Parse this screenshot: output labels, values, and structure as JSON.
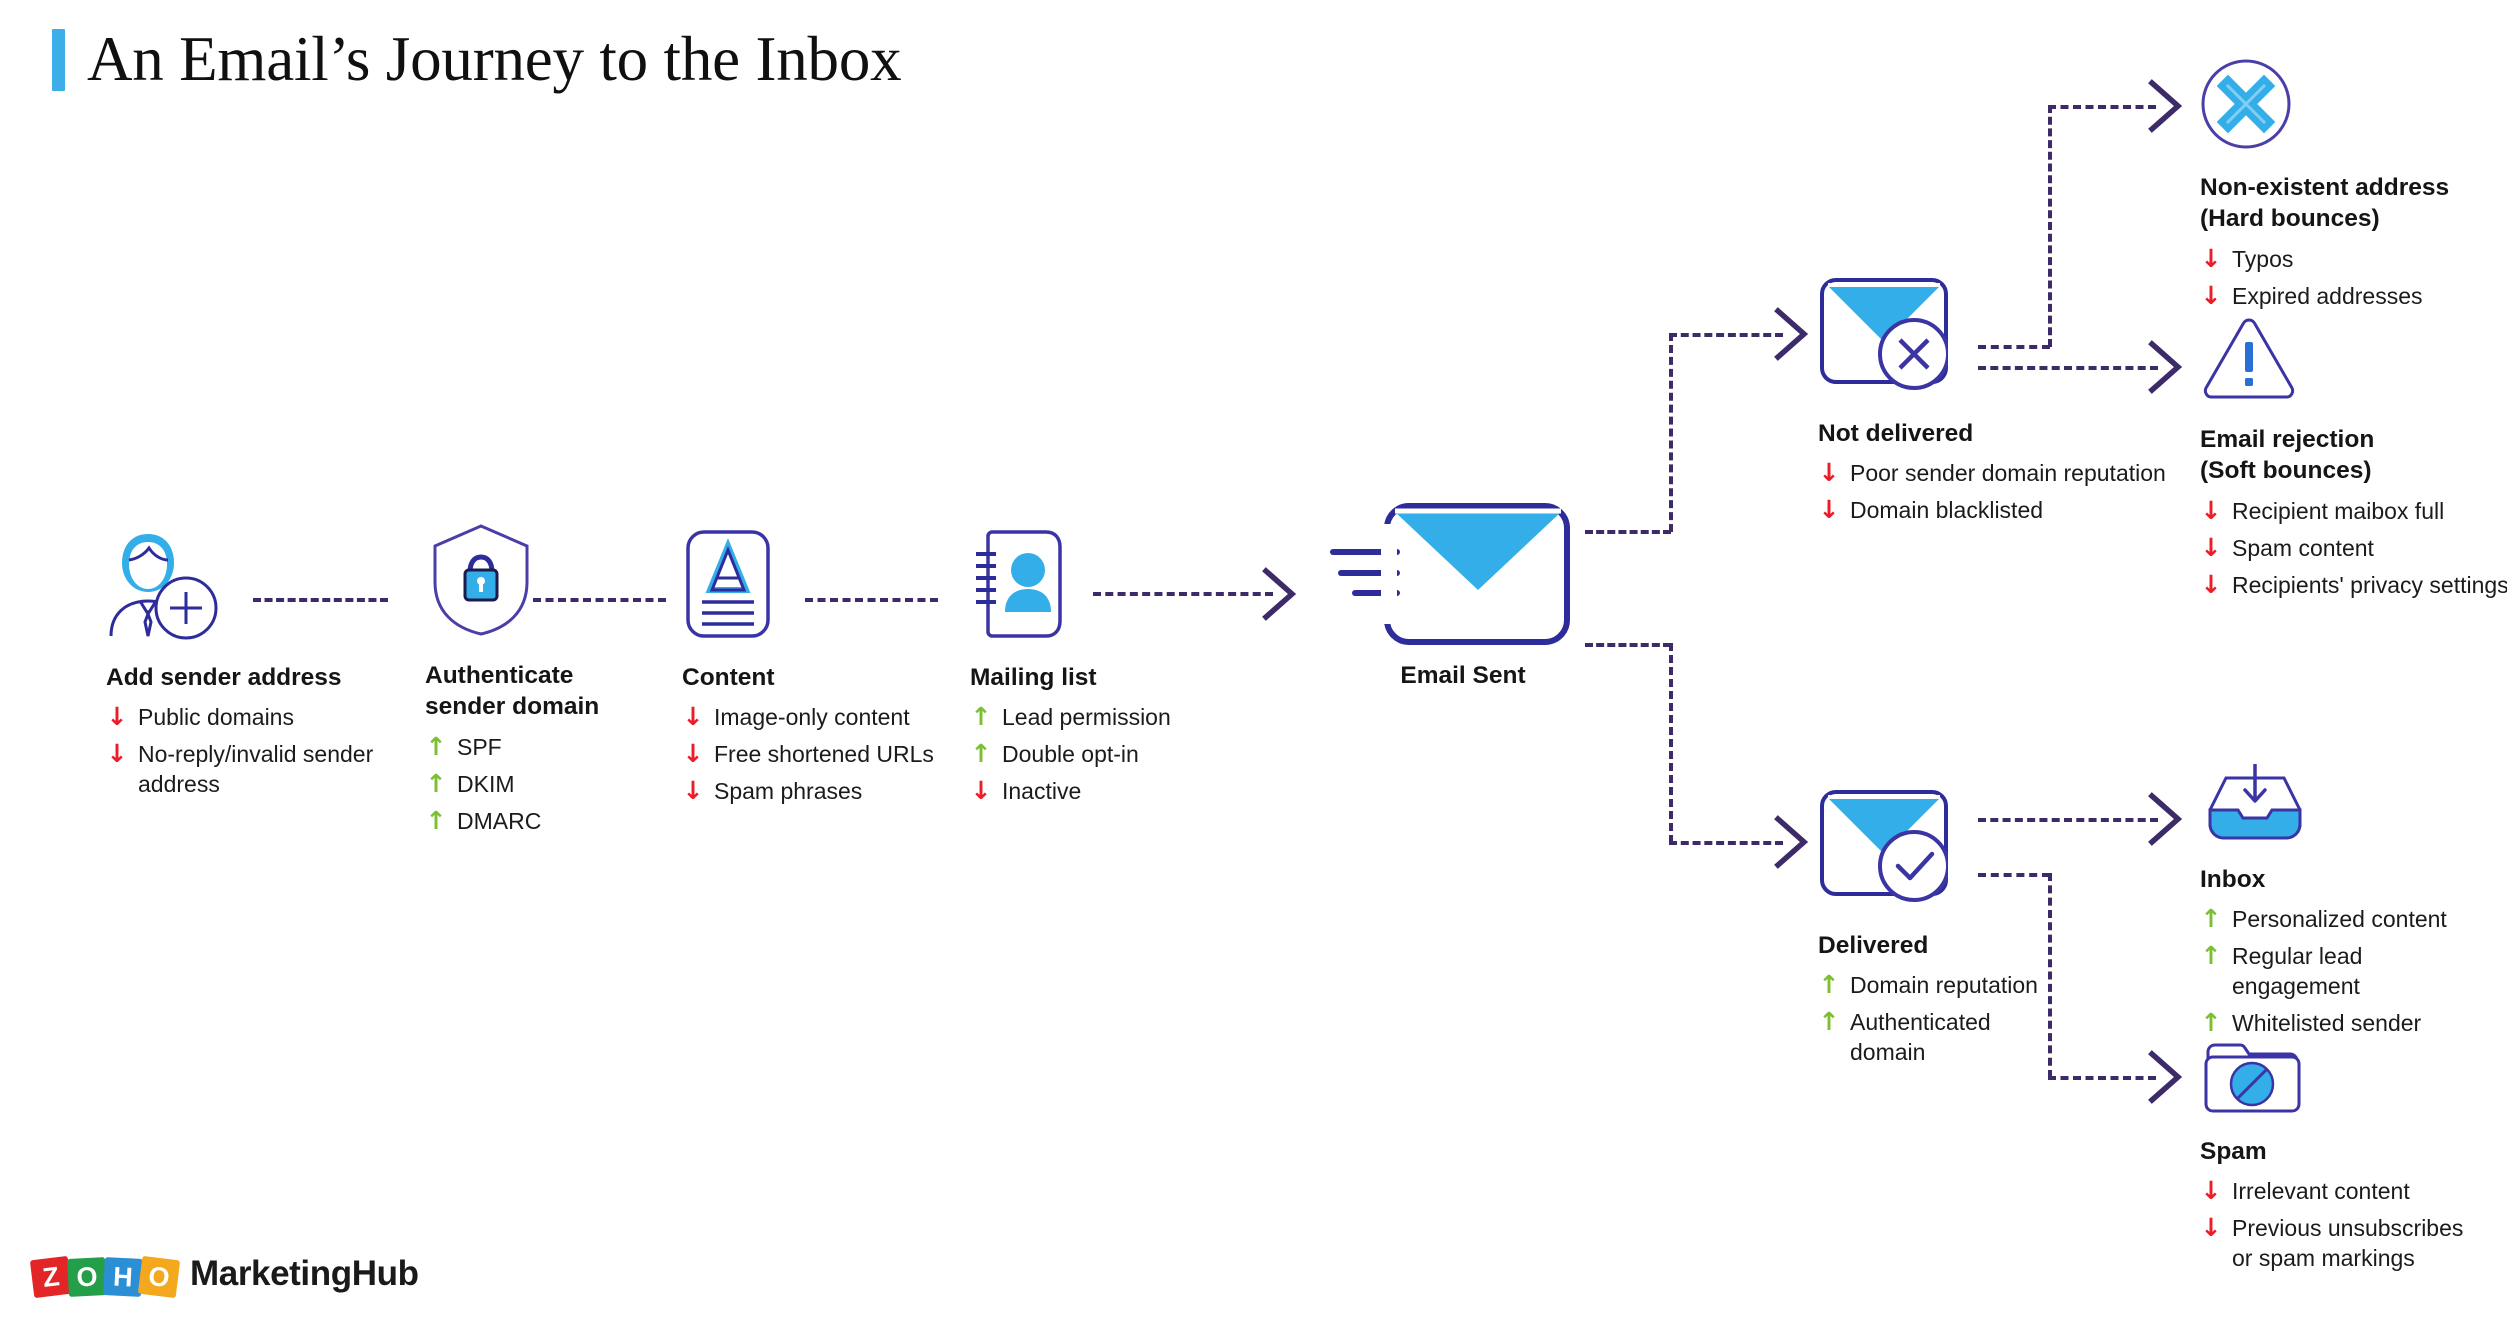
{
  "header": {
    "title": "An Email’s Journey to the Inbox",
    "accent_color": "#3DAEE8"
  },
  "colors": {
    "negative_arrow": "#EC1C28",
    "positive_arrow": "#7DBF32",
    "connector": "#3C2B68",
    "icon_outline": "#2E2C9B",
    "icon_fill": "#33AEE8"
  },
  "glyphs": {
    "down": "↓",
    "up": "↑"
  },
  "pipeline": [
    {
      "id": "add-sender-address",
      "icon": "user-add-icon",
      "title": "Add sender address",
      "bullets": [
        {
          "dir": "down",
          "text": "Public domains"
        },
        {
          "dir": "down",
          "text": "No-reply/invalid sender\naddress"
        }
      ]
    },
    {
      "id": "authenticate-sender-domain",
      "icon": "shield-lock-icon",
      "title": "Authenticate\nsender domain",
      "bullets": [
        {
          "dir": "up",
          "text": "SPF"
        },
        {
          "dir": "up",
          "text": "DKIM"
        },
        {
          "dir": "up",
          "text": "DMARC"
        }
      ]
    },
    {
      "id": "content",
      "icon": "document-text-icon",
      "title": "Content",
      "bullets": [
        {
          "dir": "down",
          "text": "Image-only content"
        },
        {
          "dir": "down",
          "text": "Free shortened URLs"
        },
        {
          "dir": "down",
          "text": "Spam phrases"
        }
      ]
    },
    {
      "id": "mailing-list",
      "icon": "contact-card-icon",
      "title": "Mailing list",
      "bullets": [
        {
          "dir": "up",
          "text": "Lead permission"
        },
        {
          "dir": "up",
          "text": "Double opt-in"
        },
        {
          "dir": "down",
          "text": "Inactive"
        }
      ]
    }
  ],
  "email_sent": {
    "id": "email-sent",
    "icon": "envelope-sending-icon",
    "title": "Email Sent"
  },
  "branches": {
    "not_delivered": {
      "id": "not-delivered",
      "icon": "envelope-x-icon",
      "title": "Not delivered",
      "bullets": [
        {
          "dir": "down",
          "text": "Poor sender domain reputation"
        },
        {
          "dir": "down",
          "text": "Domain blacklisted"
        }
      ]
    },
    "delivered": {
      "id": "delivered",
      "icon": "envelope-check-icon",
      "title": "Delivered",
      "bullets": [
        {
          "dir": "up",
          "text": "Domain reputation"
        },
        {
          "dir": "up",
          "text": "Authenticated\ndomain"
        }
      ]
    }
  },
  "outcomes": [
    {
      "id": "non-existent-address",
      "icon": "circle-x-icon",
      "title": "Non-existent address\n(Hard bounces)",
      "bullets": [
        {
          "dir": "down",
          "text": "Typos"
        },
        {
          "dir": "down",
          "text": "Expired addresses"
        }
      ]
    },
    {
      "id": "email-rejection",
      "icon": "warning-triangle-icon",
      "title": "Email rejection\n(Soft bounces)",
      "bullets": [
        {
          "dir": "down",
          "text": "Recipient maibox full"
        },
        {
          "dir": "down",
          "text": "Spam content"
        },
        {
          "dir": "down",
          "text": "Recipients' privacy settings"
        }
      ]
    },
    {
      "id": "inbox",
      "icon": "inbox-tray-icon",
      "title": "Inbox",
      "bullets": [
        {
          "dir": "up",
          "text": "Personalized content"
        },
        {
          "dir": "up",
          "text": "Regular lead\nengagement"
        },
        {
          "dir": "up",
          "text": "Whitelisted sender"
        }
      ]
    },
    {
      "id": "spam",
      "icon": "spam-folder-icon",
      "title": "Spam",
      "bullets": [
        {
          "dir": "down",
          "text": "Irrelevant content"
        },
        {
          "dir": "down",
          "text": "Previous unsubscribes\nor spam markings"
        }
      ]
    }
  ],
  "footer": {
    "brand_blocks": [
      {
        "letter": "Z",
        "color": "#E42527"
      },
      {
        "letter": "O",
        "color": "#249E49"
      },
      {
        "letter": "H",
        "color": "#2A8FD4"
      },
      {
        "letter": "O",
        "color": "#F4A81D"
      }
    ],
    "product": "MarketingHub"
  }
}
